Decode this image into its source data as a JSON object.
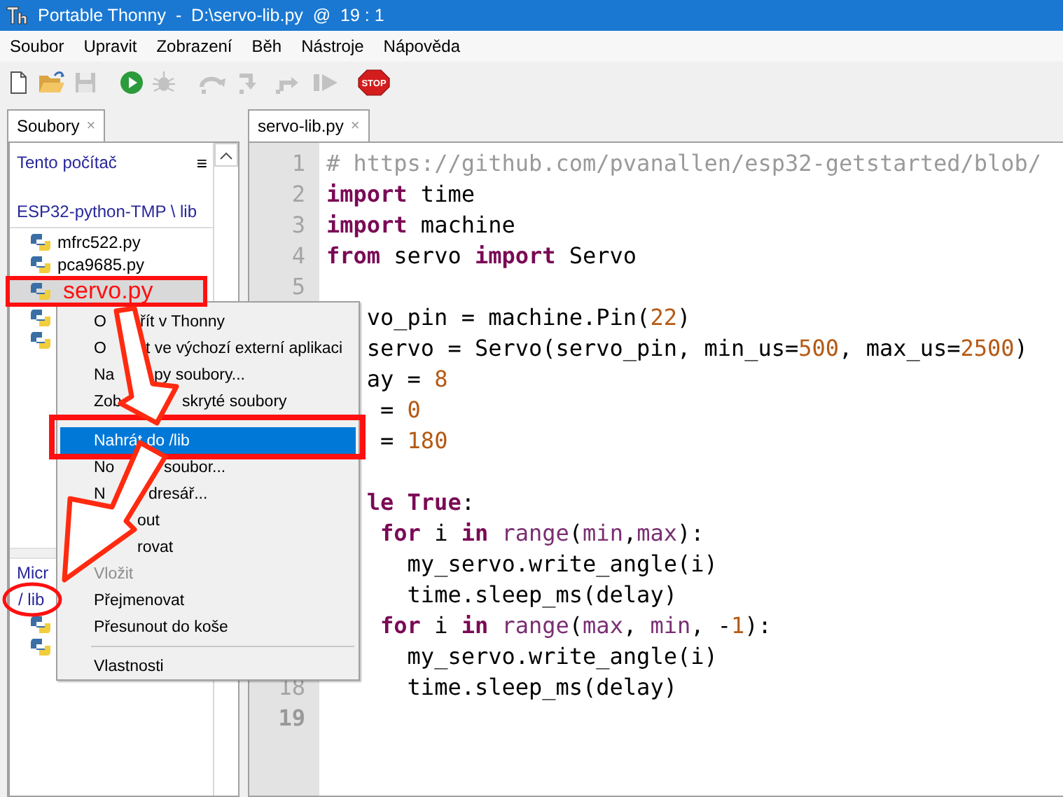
{
  "window": {
    "title": "Portable Thonny  -  D:\\servo-lib.py  @  19 : 1"
  },
  "menu_bar": [
    "Soubor",
    "Upravit",
    "Zobrazení",
    "Běh",
    "Nástroje",
    "Nápověda"
  ],
  "toolbar": [
    {
      "kind": "new",
      "disabled": false
    },
    {
      "kind": "open",
      "disabled": false
    },
    {
      "kind": "save",
      "disabled": true
    },
    {
      "kind": "run",
      "disabled": false
    },
    {
      "kind": "debug",
      "disabled": true
    },
    {
      "kind": "step-over",
      "disabled": true
    },
    {
      "kind": "step-into",
      "disabled": true
    },
    {
      "kind": "step-out",
      "disabled": true
    },
    {
      "kind": "resume",
      "disabled": true
    },
    {
      "kind": "stop",
      "disabled": false,
      "label": "STOP"
    }
  ],
  "sidebar": {
    "tab": {
      "label": "Soubory",
      "close": "×"
    },
    "local": {
      "title": "Tento počítač",
      "menu": "≡",
      "path": "ESP32-python-TMP \\ lib",
      "files": [
        {
          "name": "mfrc522.py",
          "selected": false
        },
        {
          "name": "pca9685.py",
          "selected": false
        },
        {
          "name": "servo.py",
          "selected": true
        },
        {
          "selected": false
        },
        {
          "selected": false
        }
      ]
    },
    "device": {
      "title": "Micr",
      "path": "/ lib",
      "files": [
        {
          "selected": false
        },
        {
          "selected": false
        }
      ]
    }
  },
  "editor": {
    "tab": {
      "label": "servo-lib.py",
      "close": "×"
    },
    "lines": [
      {
        "number": "1",
        "current": false,
        "tokens": [
          {
            "kind": "comment",
            "text": "# https://github.com/pvanallen/esp32-getstarted/blob/"
          }
        ]
      },
      {
        "number": "2",
        "current": false,
        "tokens": [
          {
            "kind": "kw",
            "text": "import"
          },
          {
            "kind": "plain",
            "text": " time"
          }
        ]
      },
      {
        "number": "3",
        "current": false,
        "tokens": [
          {
            "kind": "kw",
            "text": "import"
          },
          {
            "kind": "plain",
            "text": " machine"
          }
        ]
      },
      {
        "number": "4",
        "current": false,
        "tokens": [
          {
            "kind": "kw",
            "text": "from"
          },
          {
            "kind": "plain",
            "text": " servo "
          },
          {
            "kind": "kw",
            "text": "import"
          },
          {
            "kind": "plain",
            "text": " Servo"
          }
        ]
      },
      {
        "number": "5",
        "current": false
      },
      {
        "tokens": [
          {
            "kind": "plain",
            "text": "   vo_pin = machine.Pin("
          },
          {
            "kind": "num",
            "text": "22"
          },
          {
            "kind": "plain",
            "text": ")"
          }
        ]
      },
      {
        "tokens": [
          {
            "kind": "plain",
            "text": "   servo = Servo(servo_pin, min_us="
          },
          {
            "kind": "num",
            "text": "500"
          },
          {
            "kind": "plain",
            "text": ", max_us="
          },
          {
            "kind": "num",
            "text": "2500"
          },
          {
            "kind": "plain",
            "text": ")"
          }
        ]
      },
      {
        "tokens": [
          {
            "kind": "plain",
            "text": "   ay = "
          },
          {
            "kind": "num",
            "text": "8"
          }
        ]
      },
      {
        "tokens": [
          {
            "kind": "plain",
            "text": "    = "
          },
          {
            "kind": "num",
            "text": "0"
          }
        ]
      },
      {
        "tokens": [
          {
            "kind": "plain",
            "text": "    = "
          },
          {
            "kind": "num",
            "text": "180"
          }
        ]
      },
      {
        "kind": "blank"
      },
      {
        "tokens": [
          {
            "kind": "kw",
            "text": "   le"
          },
          {
            "kind": "kw",
            "text": " True"
          },
          {
            "kind": "plain",
            "text": ":"
          }
        ]
      },
      {
        "tokens": [
          {
            "kind": "kw",
            "text": "    for"
          },
          {
            "kind": "plain",
            "text": " i "
          },
          {
            "kind": "kw",
            "text": "in"
          },
          {
            "kind": "builtin",
            "text": " range"
          },
          {
            "kind": "plain",
            "text": "("
          },
          {
            "kind": "builtin",
            "text": "min"
          },
          {
            "kind": "plain",
            "text": ","
          },
          {
            "kind": "builtin",
            "text": "max"
          },
          {
            "kind": "plain",
            "text": "):"
          }
        ]
      },
      {
        "tokens": [
          {
            "kind": "plain",
            "text": "      my_servo.write_angle(i)"
          }
        ]
      },
      {
        "tokens": [
          {
            "kind": "plain",
            "text": "      time.sleep_ms(delay)"
          }
        ]
      },
      {
        "tokens": [
          {
            "kind": "kw",
            "text": "    for"
          },
          {
            "kind": "plain",
            "text": " i "
          },
          {
            "kind": "kw",
            "text": "in"
          },
          {
            "kind": "builtin",
            "text": " range"
          },
          {
            "kind": "plain",
            "text": "("
          },
          {
            "kind": "builtin",
            "text": "max"
          },
          {
            "kind": "plain",
            "text": ", "
          },
          {
            "kind": "builtin",
            "text": "min"
          },
          {
            "kind": "plain",
            "text": ", -"
          },
          {
            "kind": "num",
            "text": "1"
          },
          {
            "kind": "plain",
            "text": "):"
          }
        ]
      },
      {
        "tokens": [
          {
            "kind": "plain",
            "text": "      my_servo.write_angle(i)"
          }
        ]
      },
      {
        "number": "18",
        "current": false,
        "tokens": [
          {
            "kind": "plain",
            "text": "      time.sleep_ms(delay)"
          }
        ]
      },
      {
        "number": "19",
        "current": true
      }
    ]
  },
  "context_menu": {
    "items": [
      {
        "kind": "item",
        "parts": [
          "O",
          "řít v Thonny"
        ],
        "selected": false,
        "disabled": false
      },
      {
        "kind": "item",
        "parts": [
          "O",
          "t ve výchozí externí aplikaci"
        ],
        "selected": false,
        "disabled": false
      },
      {
        "kind": "item",
        "parts": [
          "Na",
          "py soubory..."
        ],
        "selected": false,
        "disabled": false
      },
      {
        "kind": "item",
        "parts": [
          "Zob",
          "skryté soubory"
        ],
        "selected": false,
        "disabled": false
      },
      {
        "kind": "item",
        "parts": [
          "Nahrát do /lib"
        ],
        "selected": true,
        "disabled": false
      },
      {
        "kind": "item",
        "parts": [
          "No",
          "soubor..."
        ],
        "selected": false,
        "disabled": false
      },
      {
        "kind": "item",
        "parts": [
          "N",
          "dresář..."
        ],
        "selected": false,
        "disabled": false
      },
      {
        "kind": "item",
        "parts": [
          "out"
        ],
        "selected": false,
        "disabled": false
      },
      {
        "kind": "item",
        "parts": [
          "rovat"
        ],
        "selected": false,
        "disabled": false
      },
      {
        "kind": "item",
        "parts": [
          "Vložit"
        ],
        "selected": false,
        "disabled": true
      },
      {
        "kind": "item",
        "parts": [
          "Přejmenovat"
        ],
        "selected": false,
        "disabled": false
      },
      {
        "kind": "item",
        "parts": [
          "Přesunout do koše"
        ],
        "selected": false,
        "disabled": false
      },
      {
        "kind": "separator"
      },
      {
        "kind": "item",
        "parts": [
          "Vlastnosti"
        ],
        "selected": false,
        "disabled": false
      }
    ]
  }
}
